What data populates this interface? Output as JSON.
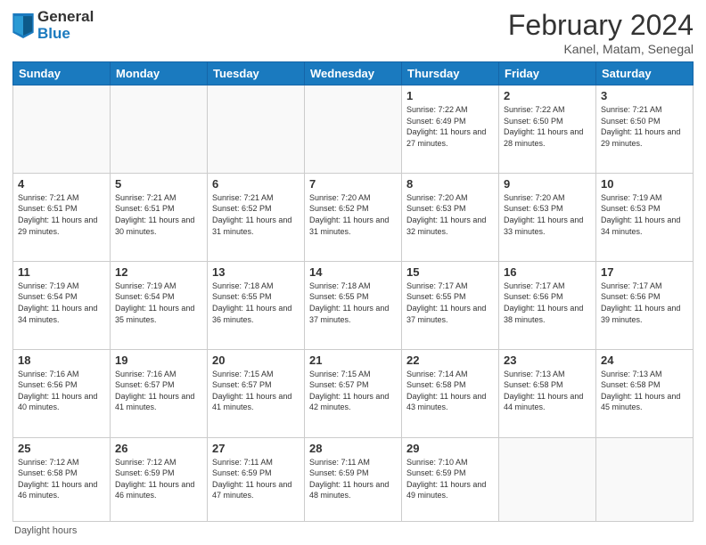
{
  "header": {
    "logo_general": "General",
    "logo_blue": "Blue",
    "title": "February 2024",
    "location": "Kanel, Matam, Senegal"
  },
  "weekdays": [
    "Sunday",
    "Monday",
    "Tuesday",
    "Wednesday",
    "Thursday",
    "Friday",
    "Saturday"
  ],
  "footer": "Daylight hours",
  "weeks": [
    [
      {
        "day": "",
        "empty": true
      },
      {
        "day": "",
        "empty": true
      },
      {
        "day": "",
        "empty": true
      },
      {
        "day": "",
        "empty": true
      },
      {
        "day": "1",
        "sunrise": "7:22 AM",
        "sunset": "6:49 PM",
        "daylight": "11 hours and 27 minutes."
      },
      {
        "day": "2",
        "sunrise": "7:22 AM",
        "sunset": "6:50 PM",
        "daylight": "11 hours and 28 minutes."
      },
      {
        "day": "3",
        "sunrise": "7:21 AM",
        "sunset": "6:50 PM",
        "daylight": "11 hours and 29 minutes."
      }
    ],
    [
      {
        "day": "4",
        "sunrise": "7:21 AM",
        "sunset": "6:51 PM",
        "daylight": "11 hours and 29 minutes."
      },
      {
        "day": "5",
        "sunrise": "7:21 AM",
        "sunset": "6:51 PM",
        "daylight": "11 hours and 30 minutes."
      },
      {
        "day": "6",
        "sunrise": "7:21 AM",
        "sunset": "6:52 PM",
        "daylight": "11 hours and 31 minutes."
      },
      {
        "day": "7",
        "sunrise": "7:20 AM",
        "sunset": "6:52 PM",
        "daylight": "11 hours and 31 minutes."
      },
      {
        "day": "8",
        "sunrise": "7:20 AM",
        "sunset": "6:53 PM",
        "daylight": "11 hours and 32 minutes."
      },
      {
        "day": "9",
        "sunrise": "7:20 AM",
        "sunset": "6:53 PM",
        "daylight": "11 hours and 33 minutes."
      },
      {
        "day": "10",
        "sunrise": "7:19 AM",
        "sunset": "6:53 PM",
        "daylight": "11 hours and 34 minutes."
      }
    ],
    [
      {
        "day": "11",
        "sunrise": "7:19 AM",
        "sunset": "6:54 PM",
        "daylight": "11 hours and 34 minutes."
      },
      {
        "day": "12",
        "sunrise": "7:19 AM",
        "sunset": "6:54 PM",
        "daylight": "11 hours and 35 minutes."
      },
      {
        "day": "13",
        "sunrise": "7:18 AM",
        "sunset": "6:55 PM",
        "daylight": "11 hours and 36 minutes."
      },
      {
        "day": "14",
        "sunrise": "7:18 AM",
        "sunset": "6:55 PM",
        "daylight": "11 hours and 37 minutes."
      },
      {
        "day": "15",
        "sunrise": "7:17 AM",
        "sunset": "6:55 PM",
        "daylight": "11 hours and 37 minutes."
      },
      {
        "day": "16",
        "sunrise": "7:17 AM",
        "sunset": "6:56 PM",
        "daylight": "11 hours and 38 minutes."
      },
      {
        "day": "17",
        "sunrise": "7:17 AM",
        "sunset": "6:56 PM",
        "daylight": "11 hours and 39 minutes."
      }
    ],
    [
      {
        "day": "18",
        "sunrise": "7:16 AM",
        "sunset": "6:56 PM",
        "daylight": "11 hours and 40 minutes."
      },
      {
        "day": "19",
        "sunrise": "7:16 AM",
        "sunset": "6:57 PM",
        "daylight": "11 hours and 41 minutes."
      },
      {
        "day": "20",
        "sunrise": "7:15 AM",
        "sunset": "6:57 PM",
        "daylight": "11 hours and 41 minutes."
      },
      {
        "day": "21",
        "sunrise": "7:15 AM",
        "sunset": "6:57 PM",
        "daylight": "11 hours and 42 minutes."
      },
      {
        "day": "22",
        "sunrise": "7:14 AM",
        "sunset": "6:58 PM",
        "daylight": "11 hours and 43 minutes."
      },
      {
        "day": "23",
        "sunrise": "7:13 AM",
        "sunset": "6:58 PM",
        "daylight": "11 hours and 44 minutes."
      },
      {
        "day": "24",
        "sunrise": "7:13 AM",
        "sunset": "6:58 PM",
        "daylight": "11 hours and 45 minutes."
      }
    ],
    [
      {
        "day": "25",
        "sunrise": "7:12 AM",
        "sunset": "6:58 PM",
        "daylight": "11 hours and 46 minutes."
      },
      {
        "day": "26",
        "sunrise": "7:12 AM",
        "sunset": "6:59 PM",
        "daylight": "11 hours and 46 minutes."
      },
      {
        "day": "27",
        "sunrise": "7:11 AM",
        "sunset": "6:59 PM",
        "daylight": "11 hours and 47 minutes."
      },
      {
        "day": "28",
        "sunrise": "7:11 AM",
        "sunset": "6:59 PM",
        "daylight": "11 hours and 48 minutes."
      },
      {
        "day": "29",
        "sunrise": "7:10 AM",
        "sunset": "6:59 PM",
        "daylight": "11 hours and 49 minutes."
      },
      {
        "day": "",
        "empty": true
      },
      {
        "day": "",
        "empty": true
      }
    ]
  ]
}
